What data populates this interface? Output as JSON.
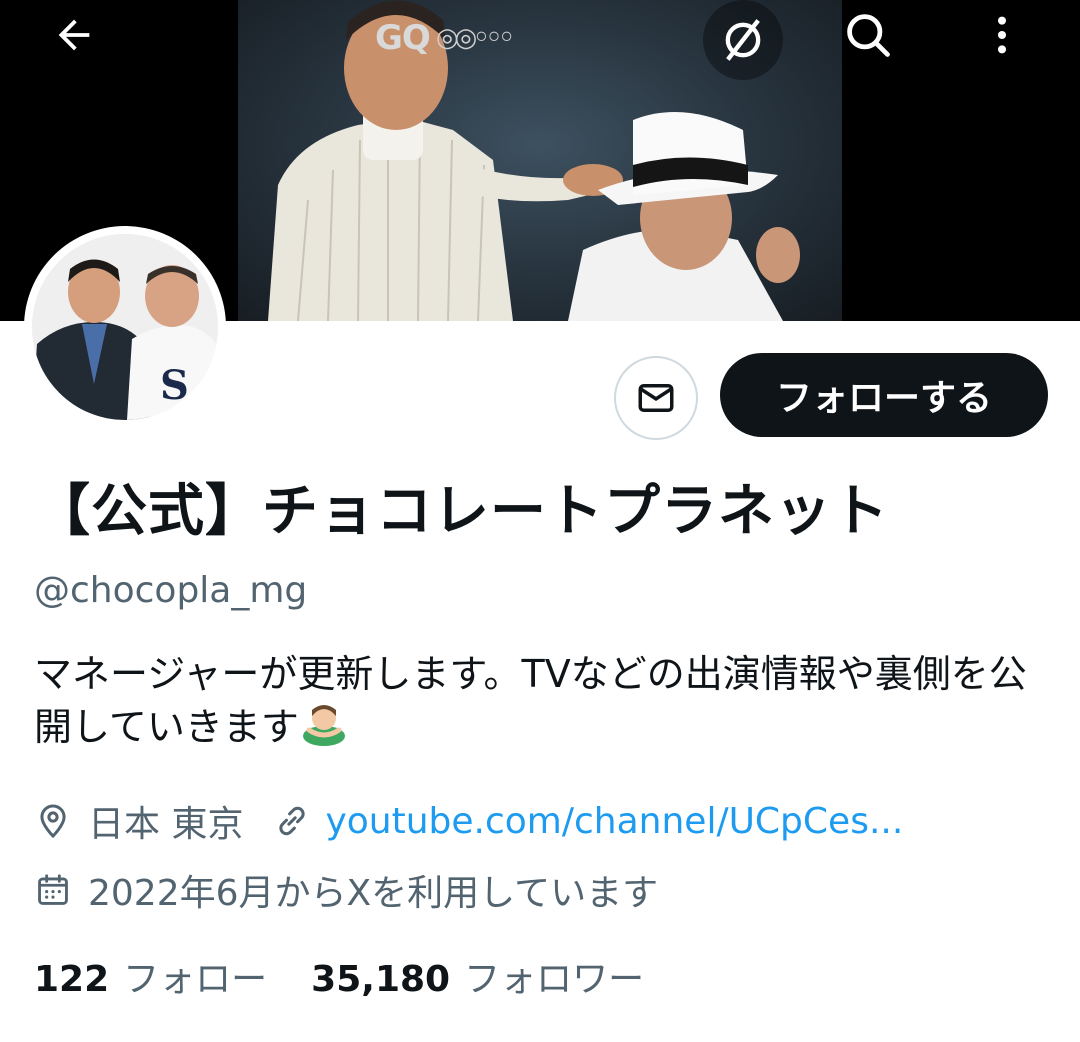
{
  "header": {
    "back_icon": "arrow-left-icon",
    "sound_icon": "sound-off-icon",
    "search_icon": "search-icon",
    "more_icon": "more-vertical-icon"
  },
  "banner": {
    "brand_text": "GQ",
    "description": "Two comedians in suits and a white hat posing against a dark backdrop"
  },
  "profile": {
    "display_name": "【公式】チョコレートプラネット",
    "handle": "@chocopla_mg",
    "bio": "マネージャーが更新します。TVなどの出演情報や裏側を公開していきます",
    "bio_emoji": "man-bowing-emoji",
    "location": "日本 東京",
    "website": "youtube.com/channel/UCpCes...",
    "joined": "2022年6月からXを利用しています",
    "following_count": "122",
    "following_label": "フォロー",
    "followers_count": "35,180",
    "followers_label": "フォロワー"
  },
  "actions": {
    "message_icon": "mail-icon",
    "follow_label": "フォローする"
  },
  "colors": {
    "text": "#0f1419",
    "secondary": "#536471",
    "link": "#1d9bf0",
    "button_dark": "#0f1419",
    "border": "#cfd9de"
  }
}
